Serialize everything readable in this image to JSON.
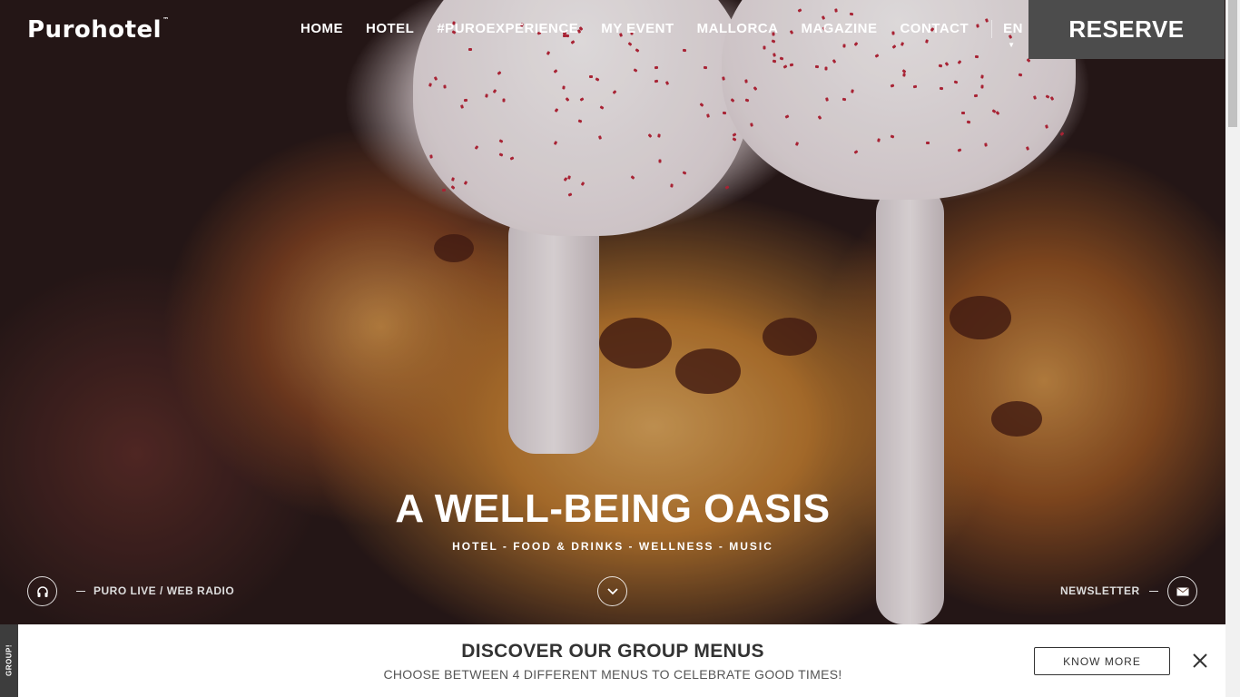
{
  "brand": {
    "logo_text": "Purohotel",
    "logo_mark": "™"
  },
  "nav": {
    "items": [
      {
        "label": "HOME"
      },
      {
        "label": "HOTEL"
      },
      {
        "label": "#PUROEXPERIENCE"
      },
      {
        "label": "MY EVENT"
      },
      {
        "label": "MALLORCA"
      },
      {
        "label": "MAGAZINE"
      },
      {
        "label": "CONTACT"
      }
    ],
    "language": "EN",
    "reserve_label": "RESERVE"
  },
  "hero": {
    "headline": "A WELL-BEING OASIS",
    "subline": "HOTEL - FOOD & DRINKS - WELLNESS - MUSIC",
    "radio_primary": "PURO LIVE",
    "radio_separator": "/",
    "radio_secondary": "WEB RADIO",
    "newsletter_label": "NEWSLETTER",
    "icons": {
      "radio": "headphones-icon",
      "scroll": "chevron-down-icon",
      "newsletter": "envelope-icon"
    }
  },
  "banner": {
    "tab_label": "GROUP!",
    "title": "DISCOVER OUR GROUP MENUS",
    "subtitle": "CHOOSE BETWEEN 4 DIFFERENT MENUS TO CELEBRATE GOOD TIMES!",
    "cta_label": "KNOW MORE"
  },
  "colors": {
    "reserve_bg": "#4c4c4c",
    "banner_bg": "#ffffff",
    "banner_tab_bg": "#3d3d3d"
  }
}
